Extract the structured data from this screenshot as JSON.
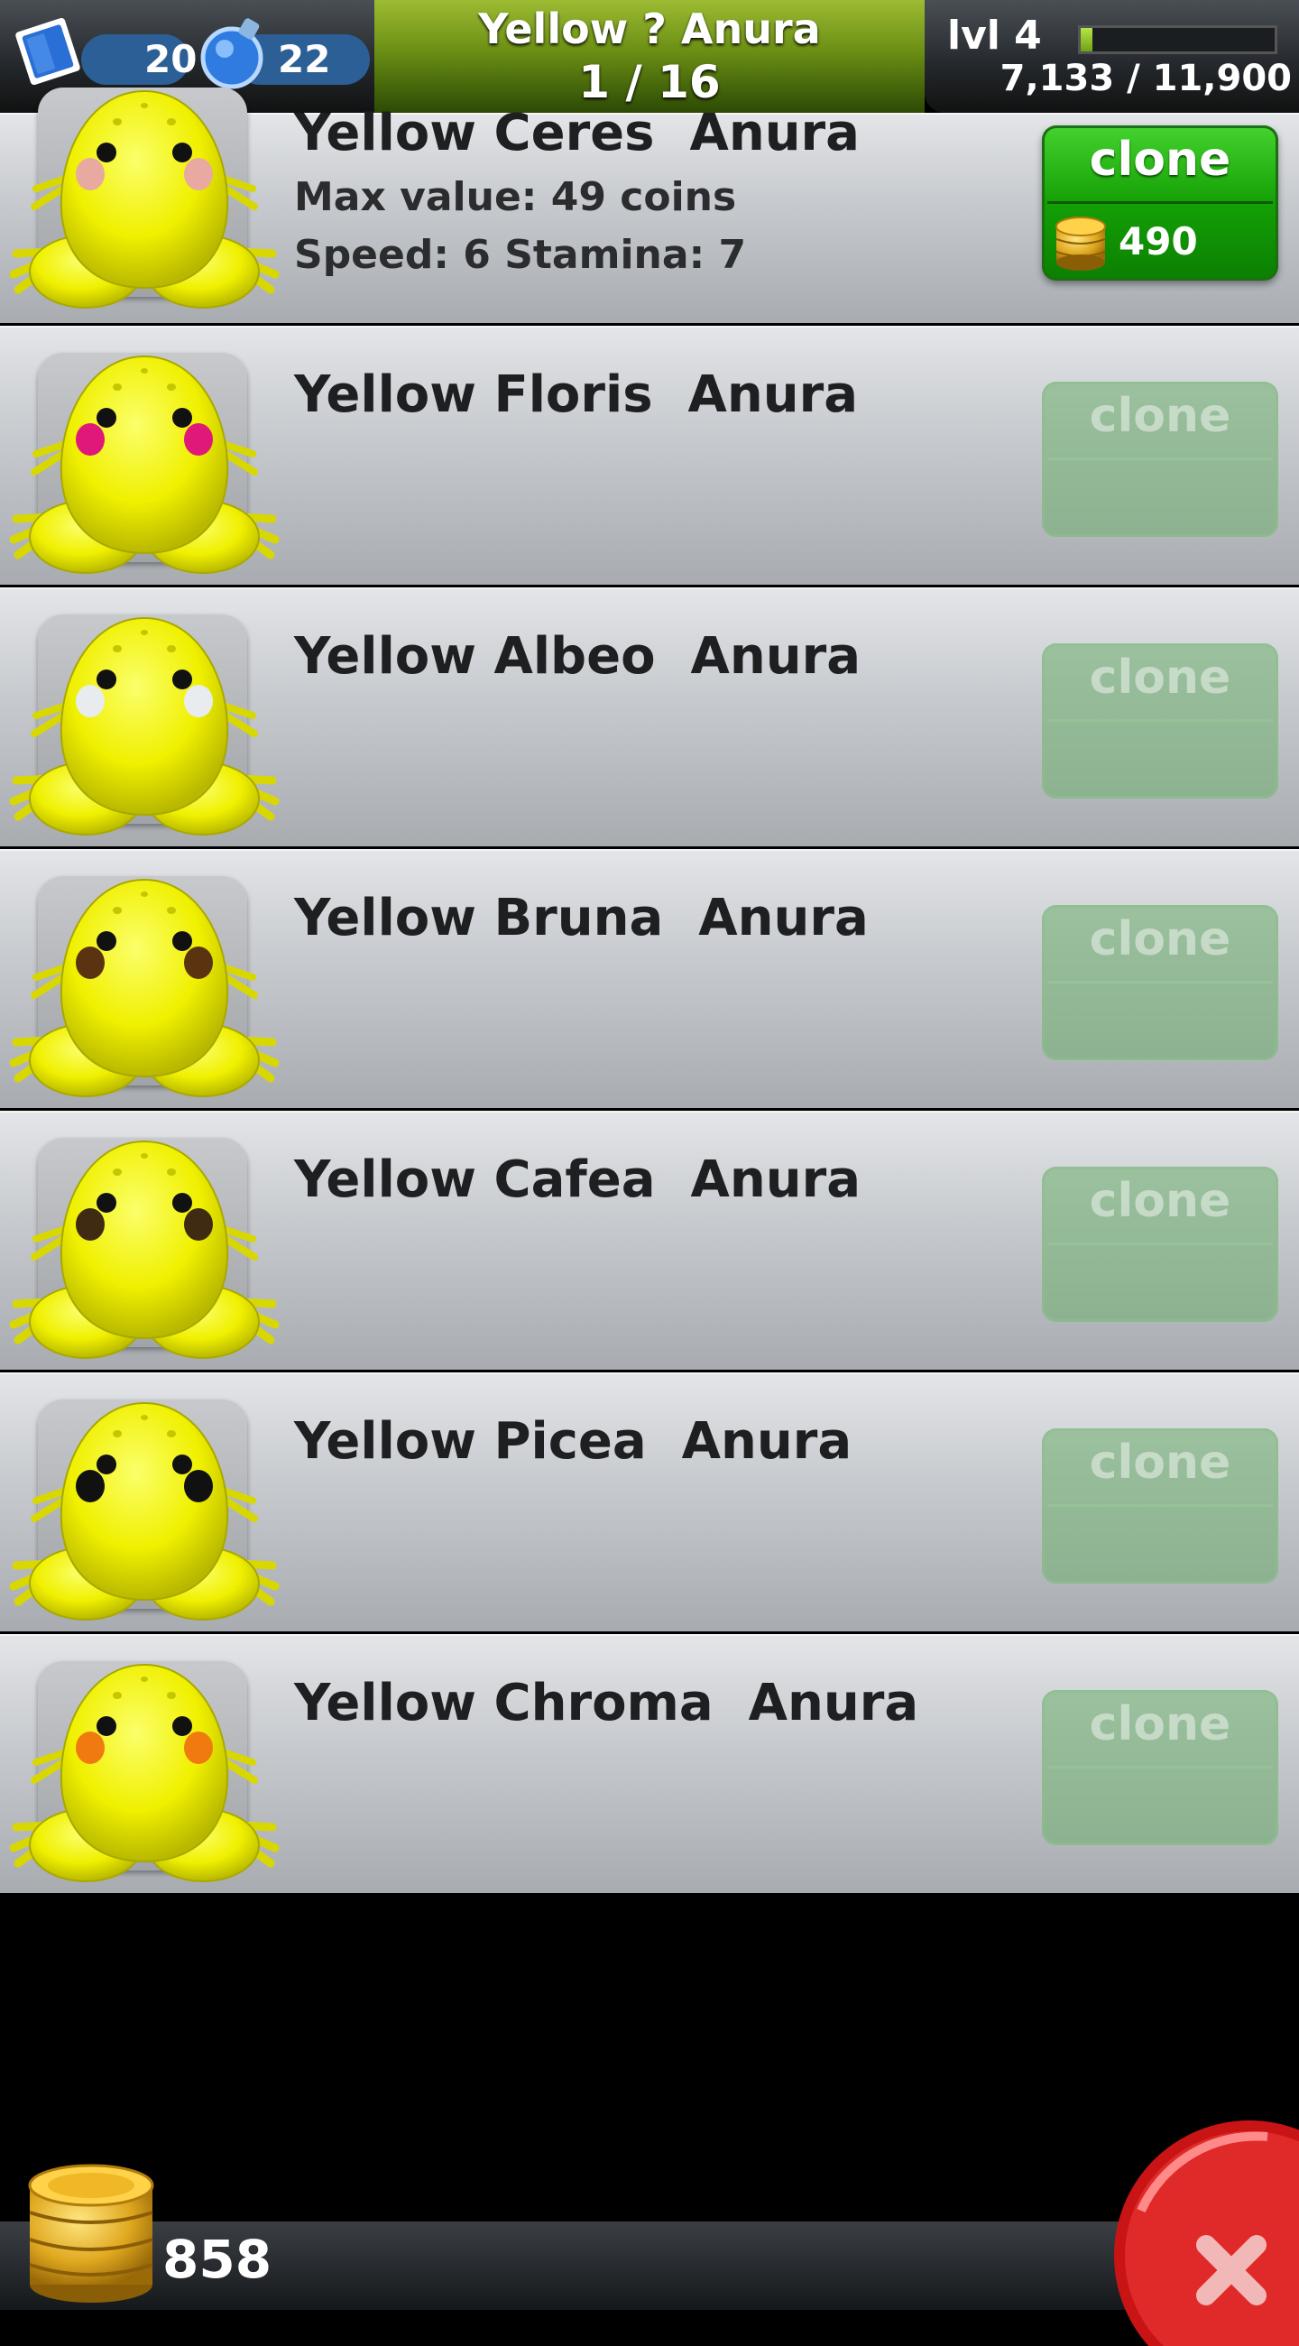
{
  "header": {
    "title": "Yellow ? Anura",
    "page": "1 / 16",
    "stamps": "20",
    "potions": "22",
    "level": "lvl 4",
    "xp_text": "7,133 / 11,900",
    "xp_fraction": 0.06
  },
  "frogs": [
    {
      "name": "Yellow Ceres  Anura",
      "max_value": "Max value: 49 coins",
      "stats": "Speed: 6  Stamina:  7",
      "button": "clone",
      "price": "490",
      "enabled": true,
      "cheek_color": "#e8a9a0"
    },
    {
      "name": "Yellow Floris  Anura",
      "button": "clone",
      "enabled": false,
      "cheek_color": "#e0187a"
    },
    {
      "name": "Yellow Albeo  Anura",
      "button": "clone",
      "enabled": false,
      "cheek_color": "#e9ecee"
    },
    {
      "name": "Yellow Bruna  Anura",
      "button": "clone",
      "enabled": false,
      "cheek_color": "#5a3410"
    },
    {
      "name": "Yellow Cafea  Anura",
      "button": "clone",
      "enabled": false,
      "cheek_color": "#3f2a12"
    },
    {
      "name": "Yellow Picea  Anura",
      "button": "clone",
      "enabled": false,
      "cheek_color": "#111111"
    },
    {
      "name": "Yellow Chroma  Anura",
      "button": "clone",
      "enabled": false,
      "cheek_color": "#f07a10"
    }
  ],
  "footer": {
    "coins": "858"
  },
  "icons": {
    "stamp": "blue-stamp-icon",
    "potion": "blue-potion-icon",
    "coins": "gold-coin-stack-icon",
    "close": "close-x-icon"
  }
}
